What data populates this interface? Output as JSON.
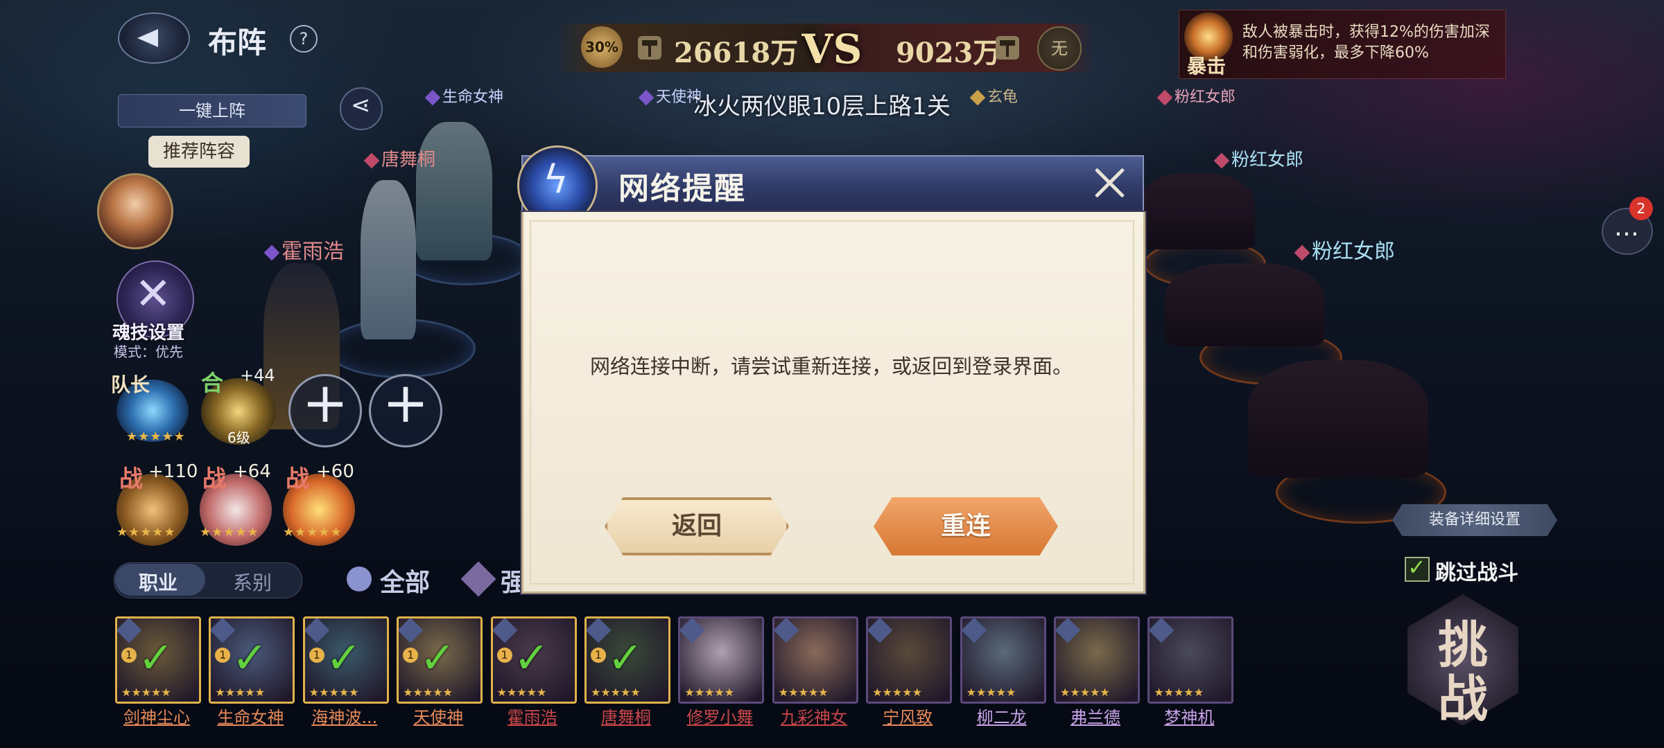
{
  "header": {
    "page_title": "布阵",
    "help_label": "?",
    "left_power_pct": "30%",
    "left_power": "26618万",
    "vs_label": "VS",
    "right_power": "9023万",
    "right_badge": "无",
    "stage_name": "冰火两仪眼10层上路1关"
  },
  "crit_panel": {
    "label": "暴击",
    "description": "敌人被暴击时，获得12%的伤害加深和伤害弱化，最多下降60%"
  },
  "left_panel": {
    "one_click_label": "一键上阵",
    "recommend_label": "推荐阵容",
    "skill_setting_label": "魂技设置",
    "skill_mode": "模式：优先",
    "leader_label": "队长",
    "combo_label": "合",
    "combo_plus": "+44",
    "combo_level": "6级",
    "war_slots": [
      {
        "label": "战",
        "plus": "+110"
      },
      {
        "label": "战",
        "plus": "+64"
      },
      {
        "label": "战",
        "plus": "+60"
      }
    ]
  },
  "battlefield_tags": {
    "ally_top1": "生命女神",
    "ally_top2": "天使神",
    "ally_name_1": "唐舞桐",
    "ally_name_2": "霍雨浩",
    "enemy_top1": "玄龟",
    "enemy_top2": "粉红女郎",
    "enemy_name_1": "粉红女郎",
    "enemy_name_2": "粉红女郎"
  },
  "modal": {
    "title": "网络提醒",
    "message": "网络连接中断，请尝试重新连接，或返回到登录界面。",
    "back_label": "返回",
    "reconnect_label": "重连"
  },
  "right_panel": {
    "chat_badge": "2",
    "equip_settings_label": "装备详细设置",
    "skip_battle_label": "跳过战斗",
    "challenge_label": "挑战"
  },
  "filters": {
    "tab_profession": "职业",
    "tab_series": "系别",
    "all_label": "全部",
    "strength_label": "强"
  },
  "roster": [
    {
      "name": "剑神尘心",
      "selected": true,
      "level": "1",
      "color": "#e88a5a"
    },
    {
      "name": "生命女神",
      "selected": true,
      "level": "1",
      "color": "#e88a5a"
    },
    {
      "name": "海神波...",
      "selected": true,
      "level": "1",
      "color": "#e88a5a"
    },
    {
      "name": "天使神",
      "selected": true,
      "level": "1",
      "color": "#e88a5a"
    },
    {
      "name": "霍雨浩",
      "selected": true,
      "level": "1",
      "color": "#c8464a"
    },
    {
      "name": "唐舞桐",
      "selected": true,
      "level": "1",
      "color": "#c8464a"
    },
    {
      "name": "修罗小舞",
      "selected": false,
      "level": "",
      "color": "#c8464a"
    },
    {
      "name": "九彩神女",
      "selected": false,
      "level": "",
      "color": "#c8464a"
    },
    {
      "name": "宁风致",
      "selected": false,
      "level": "",
      "color": "#e88a5a"
    },
    {
      "name": "柳二龙",
      "selected": false,
      "level": "",
      "color": "#c8a2e8"
    },
    {
      "name": "弗兰德",
      "selected": false,
      "level": "",
      "color": "#c8a2e8"
    },
    {
      "name": "梦神机",
      "selected": false,
      "level": "",
      "color": "#c8a2e8"
    }
  ]
}
